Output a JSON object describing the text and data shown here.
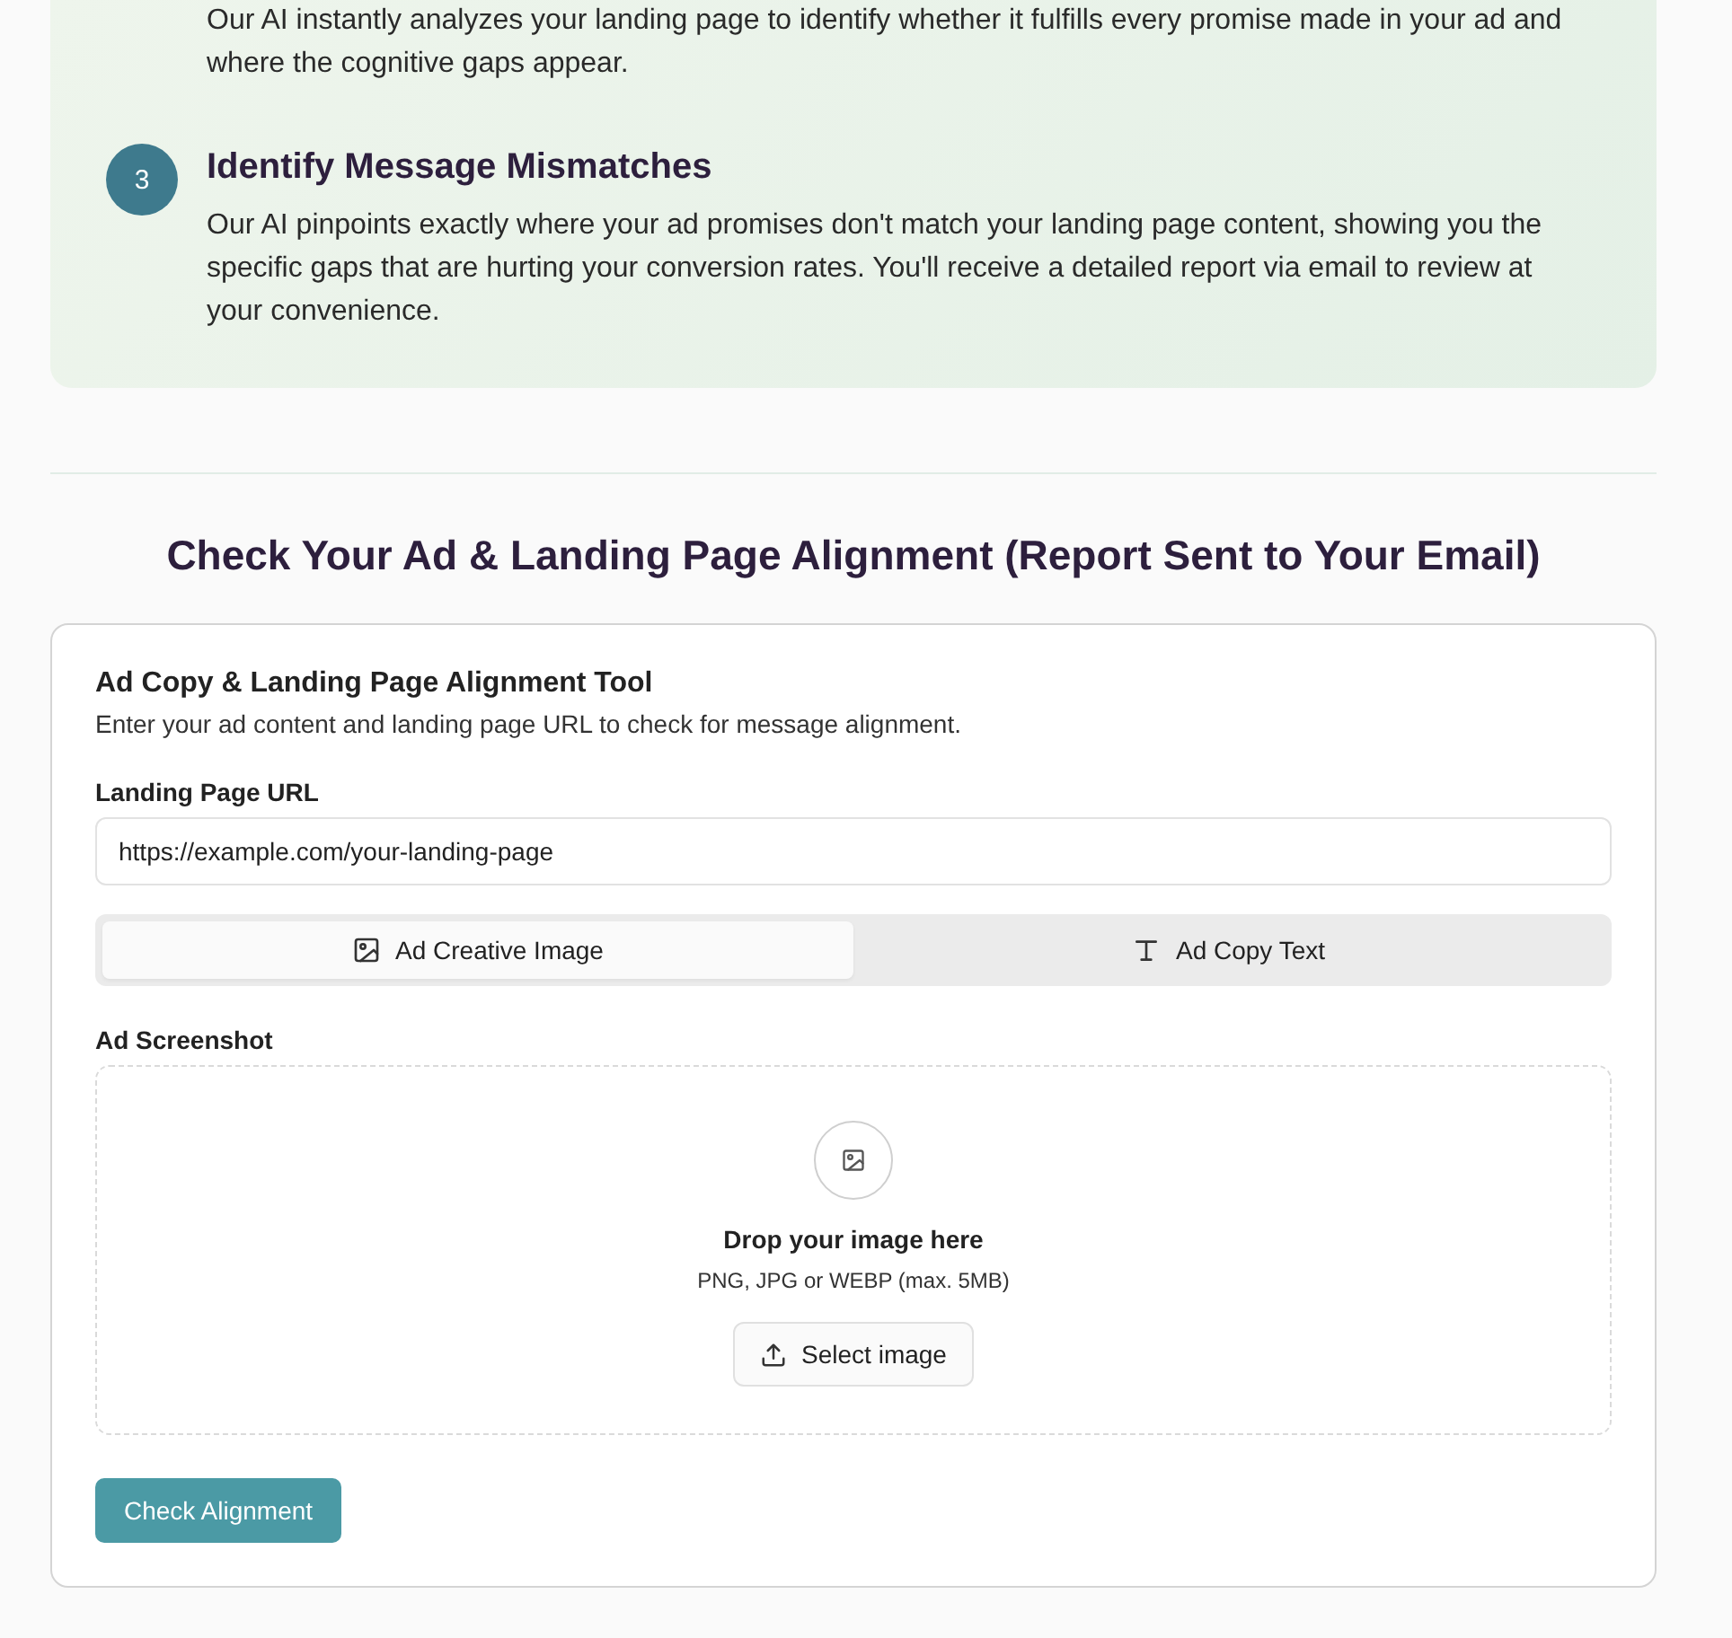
{
  "steps": [
    {
      "description": "Our AI instantly analyzes your landing page to identify whether it fulfills every promise made in your ad and where the cognitive gaps appear."
    },
    {
      "number": "3",
      "title": "Identify Message Mismatches",
      "description": "Our AI pinpoints exactly where your ad promises don't match your landing page content, showing you the specific gaps that are hurting your conversion rates. You'll receive a detailed report via email to review at your convenience."
    }
  ],
  "section_title": "Check Your Ad & Landing Page Alignment (Report Sent to Your Email)",
  "tool": {
    "title": "Ad Copy & Landing Page Alignment Tool",
    "subtitle": "Enter your ad content and landing page URL to check for message alignment.",
    "url_label": "Landing Page URL",
    "url_value": "https://example.com/your-landing-page",
    "tabs": [
      {
        "kind": "image",
        "label": "Ad Creative Image",
        "selected": true
      },
      {
        "kind": "text",
        "label": "Ad Copy Text",
        "selected": false
      }
    ],
    "upload": {
      "label": "Ad Screenshot",
      "prompt": "Drop your image here",
      "hint": "PNG, JPG or WEBP (max. 5MB)",
      "button": "Select image"
    },
    "submit": "Check Alignment"
  }
}
